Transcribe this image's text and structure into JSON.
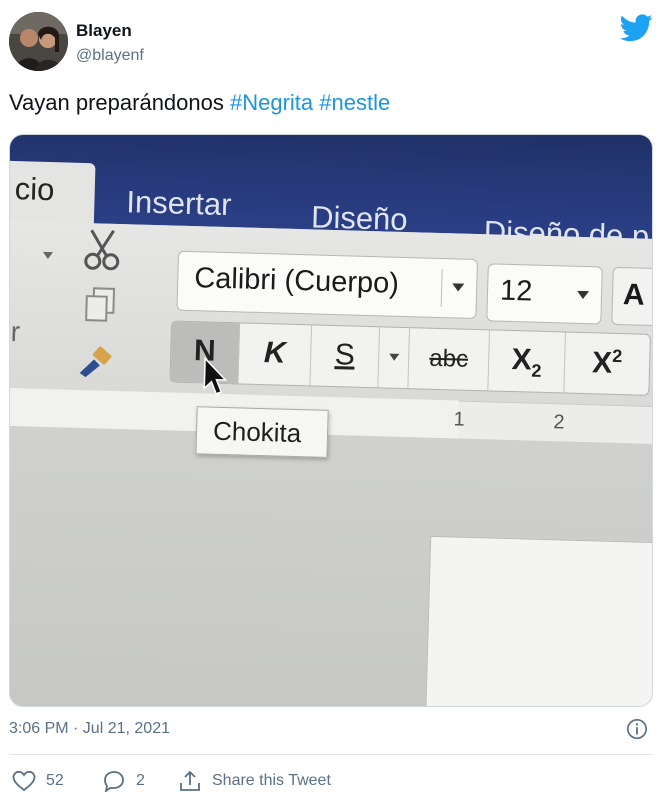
{
  "user": {
    "display_name": "Blayen",
    "handle": "@blayenf"
  },
  "tweet": {
    "text": "Vayan preparándonos ",
    "hashtags": [
      "#Negrita",
      "#nestle"
    ],
    "timestamp": "3:06 PM · Jul 21, 2021"
  },
  "actions": {
    "likes": "52",
    "replies": "2",
    "share_label": "Share this Tweet"
  },
  "photo": {
    "tabs": [
      "cio",
      "Insertar",
      "Diseño",
      "Diseño de p"
    ],
    "font_name": "Calibri (Cuerpo)",
    "font_size": "12",
    "grow_label": "A",
    "format_buttons": [
      "N",
      "K",
      "S",
      "abc",
      "X",
      "2",
      "X",
      "2"
    ],
    "tooltip": "Chokita",
    "ruler_numbers": [
      "1",
      "2"
    ],
    "left_label": "r"
  },
  "colors": {
    "twitter_blue": "#1da1f2",
    "hashtag": "#1b95e0",
    "ribbon": "#27397a",
    "muted": "#5b7083"
  }
}
